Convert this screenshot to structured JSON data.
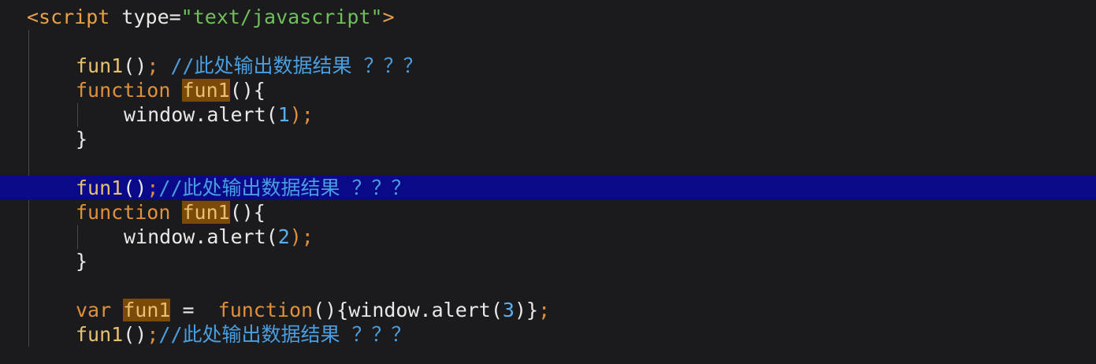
{
  "code": {
    "line1": {
      "open_tag": "<script",
      "attr": " type=",
      "value": "\"text/javascript\"",
      "close": ">"
    },
    "block1": {
      "call": "fun1",
      "call_parens": "()",
      "call_semi": ";",
      "comment": " //此处输出数据结果 ？？？",
      "keyword": "function",
      "fn_name": "fun1",
      "fn_sig": "(){",
      "body_obj": "window.alert",
      "body_open": "(",
      "arg": "1",
      "body_close": ");",
      "close_brace": "}"
    },
    "block2": {
      "call": "fun1",
      "call_parens": "()",
      "call_semi": ";",
      "comment": "//此处输出数据结果 ？？？",
      "keyword": "function",
      "fn_name": "fun1",
      "fn_sig": "(){",
      "body_obj": "window.alert",
      "body_open": "(",
      "arg": "2",
      "body_close": ");",
      "close_brace": "}"
    },
    "block3": {
      "var_kw": "var",
      "var_name": "fun1",
      "assign": " =  ",
      "fn_kw": "function",
      "fn_body_pre": "(){window.alert(",
      "arg": "3",
      "fn_body_post": ")}",
      "semi": ";",
      "call": "fun1",
      "call_parens": "()",
      "call_semi": ";",
      "comment": "//此处输出数据结果 ？？？"
    }
  }
}
